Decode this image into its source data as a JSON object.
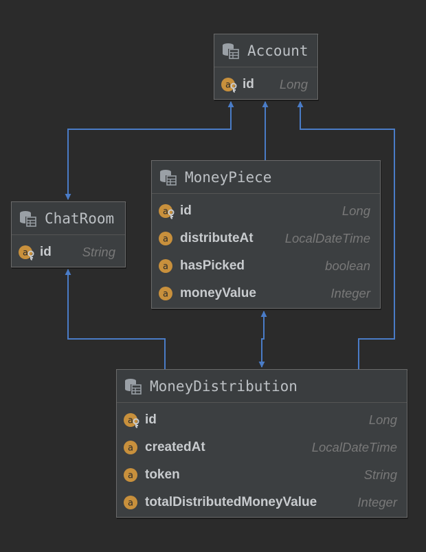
{
  "entities": {
    "account": {
      "title": "Account",
      "fields": [
        {
          "name": "id",
          "type": "Long",
          "icon": "attribute-key-icon"
        }
      ]
    },
    "chatroom": {
      "title": "ChatRoom",
      "fields": [
        {
          "name": "id",
          "type": "String",
          "icon": "attribute-key-icon"
        }
      ]
    },
    "moneypiece": {
      "title": "MoneyPiece",
      "fields": [
        {
          "name": "id",
          "type": "Long",
          "icon": "attribute-key-icon"
        },
        {
          "name": "distributeAt",
          "type": "LocalDateTime",
          "icon": "attribute-icon"
        },
        {
          "name": "hasPicked",
          "type": "boolean",
          "icon": "attribute-icon"
        },
        {
          "name": "moneyValue",
          "type": "Integer",
          "icon": "attribute-icon"
        }
      ]
    },
    "moneydistribution": {
      "title": "MoneyDistribution",
      "fields": [
        {
          "name": "id",
          "type": "Long",
          "icon": "attribute-key-icon"
        },
        {
          "name": "createdAt",
          "type": "LocalDateTime",
          "icon": "attribute-icon"
        },
        {
          "name": "token",
          "type": "String",
          "icon": "attribute-icon"
        },
        {
          "name": "totalDistributedMoneyValue",
          "type": "Integer",
          "icon": "attribute-icon"
        }
      ]
    }
  },
  "colors": {
    "background": "#2b2b2b",
    "edge": "#4a7cc7",
    "attribute_badge": "#c8903c"
  }
}
